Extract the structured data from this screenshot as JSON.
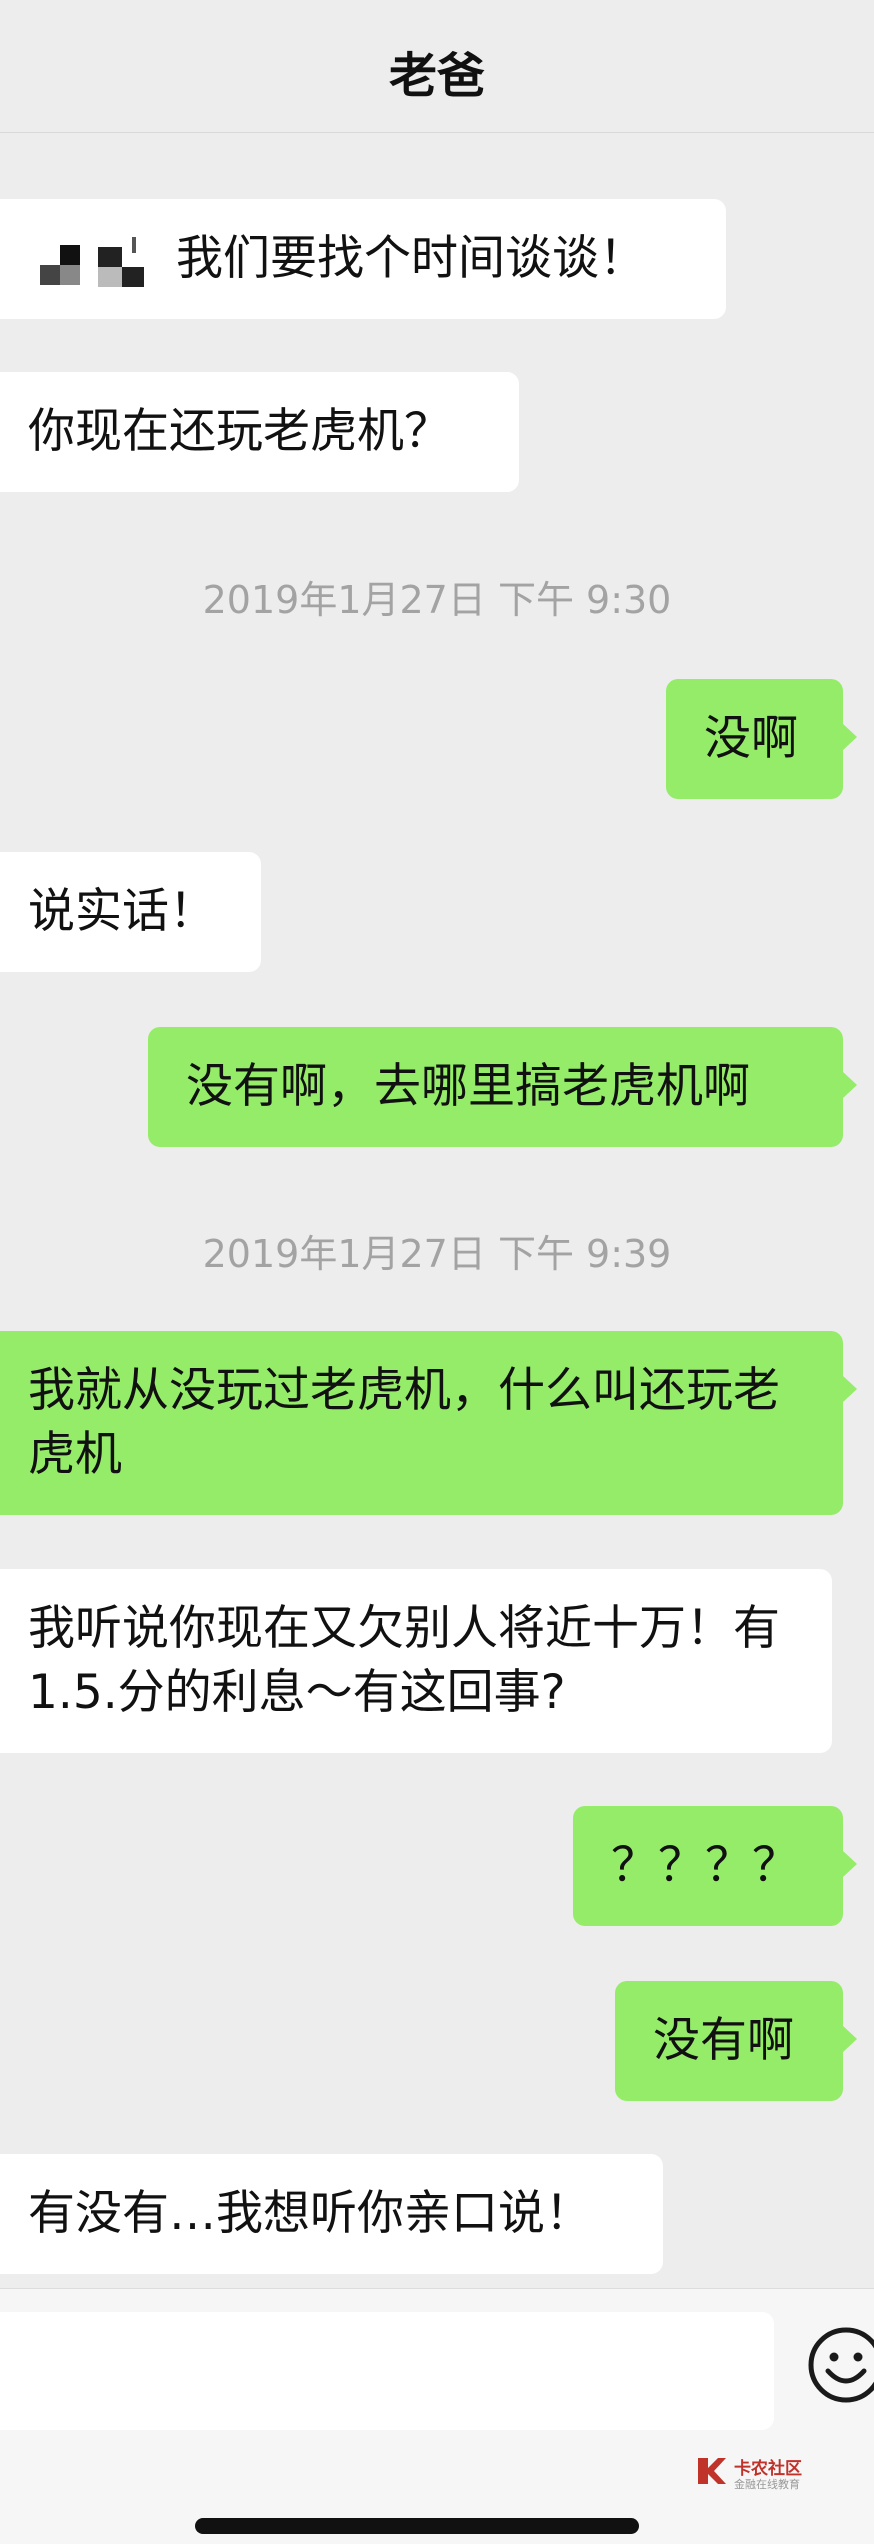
{
  "header": {
    "title": "老爸"
  },
  "messages": {
    "m1": "我们要找个时间谈谈！",
    "m2": "你现在还玩老虎机？",
    "ts1": "2019年1月27日 下午 9:30",
    "m3": "没啊",
    "m4": "说实话！",
    "m5": "没有啊，去哪里搞老虎机啊",
    "ts2": "2019年1月27日 下午 9:39",
    "m6": "我就从没玩过老虎机，什么叫还玩老虎机",
    "m7": "我听说你现在又欠别人将近十万！有1.5.分的利息～有这回事?",
    "m8": "？？？？",
    "m9": "没有啊",
    "m10": "有没有…我想听你亲口说！"
  },
  "input": {
    "value": ""
  },
  "watermark": {
    "name": "卡农社区",
    "tagline": "金融在线教育"
  },
  "colors": {
    "background": "#ededed",
    "outgoing_bubble": "#95ec69",
    "incoming_bubble": "#ffffff",
    "timestamp_text": "#a3a3a3",
    "watermark": "#c0332b"
  },
  "icons": {
    "emoji_button": "smiley-face-icon",
    "pixelated_emoji": "pixelated-emoji-icon",
    "watermark_logo": "kanong-logo-icon"
  }
}
